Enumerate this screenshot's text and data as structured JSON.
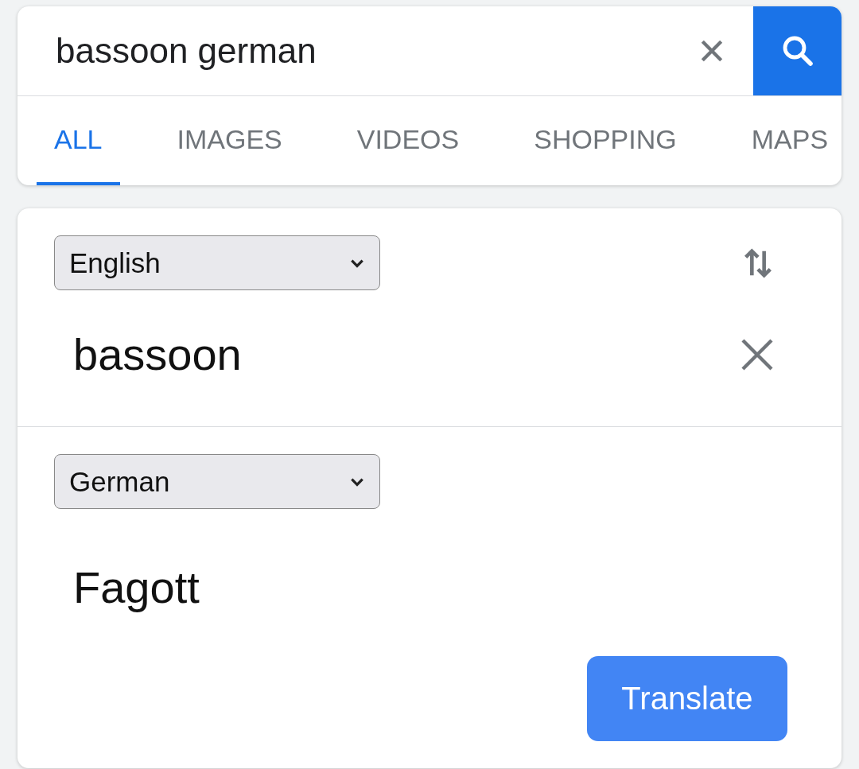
{
  "search": {
    "value": "bassoon german"
  },
  "tabs": [
    {
      "label": "ALL",
      "selected": true
    },
    {
      "label": "IMAGES",
      "selected": false
    },
    {
      "label": "VIDEOS",
      "selected": false
    },
    {
      "label": "SHOPPING",
      "selected": false
    },
    {
      "label": "MAPS",
      "selected": false
    }
  ],
  "translator": {
    "source_language": "English",
    "source_text": "bassoon",
    "target_language": "German",
    "translation": "Fagott",
    "button": "Translate"
  }
}
